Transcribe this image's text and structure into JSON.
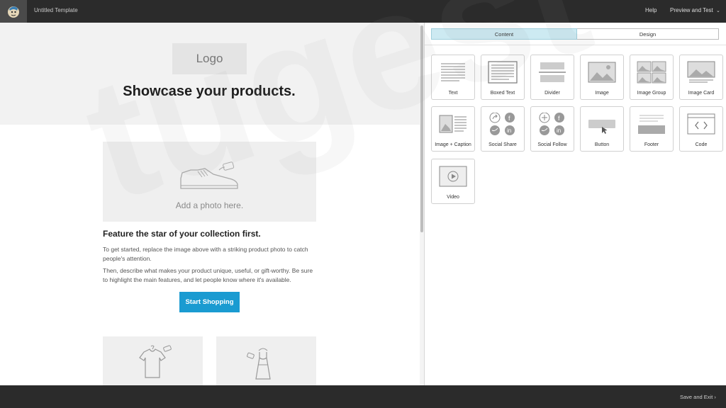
{
  "topbar": {
    "title": "Untitled Template",
    "help": "Help",
    "preview": "Preview and Test",
    "logo_icon": "chimp-logo-icon"
  },
  "canvas": {
    "logo_placeholder": "Logo",
    "headline": "Showcase your products.",
    "photo_caption": "Add a photo here.",
    "feature_title": "Feature the star of your collection first.",
    "paragraph_1": "To get started, replace the image above with a striking product photo to catch people's attention.",
    "paragraph_2": "Then, describe what makes your product unique, useful, or gift-worthy. Be sure to highlight the main features, and let people know where it's available.",
    "cta_label": "Start Shopping"
  },
  "panel": {
    "tabs": [
      {
        "label": "Content",
        "active": true
      },
      {
        "label": "Design",
        "active": false
      }
    ],
    "blocks": [
      {
        "label": "Text",
        "icon": "text-block-icon"
      },
      {
        "label": "Boxed Text",
        "icon": "boxed-text-icon"
      },
      {
        "label": "Divider",
        "icon": "divider-icon"
      },
      {
        "label": "Image",
        "icon": "image-icon"
      },
      {
        "label": "Image Group",
        "icon": "image-group-icon"
      },
      {
        "label": "Image Card",
        "icon": "image-card-icon"
      },
      {
        "label": "Image + Caption",
        "icon": "image-caption-icon"
      },
      {
        "label": "Social Share",
        "icon": "social-share-icon"
      },
      {
        "label": "Social Follow",
        "icon": "social-follow-icon"
      },
      {
        "label": "Button",
        "icon": "button-block-icon"
      },
      {
        "label": "Footer",
        "icon": "footer-icon"
      },
      {
        "label": "Code",
        "icon": "code-icon"
      },
      {
        "label": "Video",
        "icon": "video-icon"
      }
    ]
  },
  "bottombar": {
    "save_exit": "Save and Exit"
  },
  "watermark": "tugest",
  "colors": {
    "bar_bg": "#2b2b2b",
    "cta_bg": "#1a9bd1",
    "active_tab": "#cdeaf2"
  }
}
